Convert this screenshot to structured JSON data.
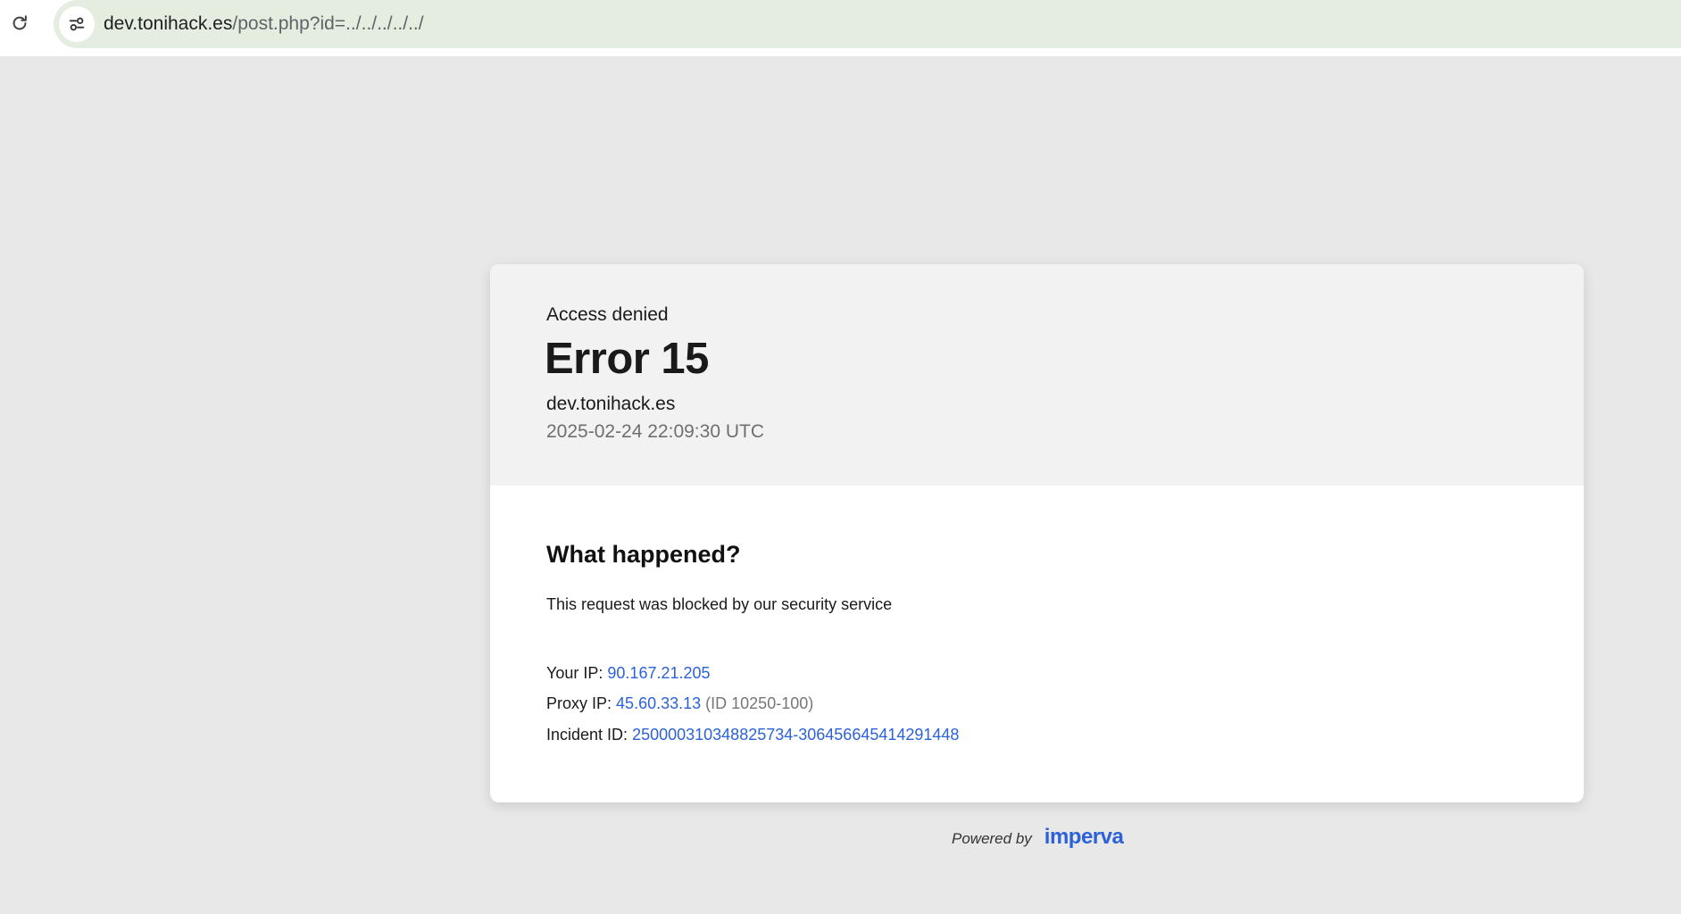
{
  "browser": {
    "url_host": "dev.tonihack.es",
    "url_path": "/post.php?id=../../../../../",
    "reload_icon": "reload-icon",
    "site_info_icon": "tune-icon"
  },
  "error_card": {
    "subtitle": "Access denied",
    "title": "Error 15",
    "host": "dev.tonihack.es",
    "timestamp": "2025-02-24 22:09:30 UTC"
  },
  "details": {
    "heading": "What happened?",
    "message": "This request was blocked by our security service",
    "your_ip_label": "Your IP:",
    "your_ip": "90.167.21.205",
    "proxy_ip_label": "Proxy IP:",
    "proxy_ip": "45.60.33.13",
    "proxy_id": "(ID 10250-100)",
    "incident_label": "Incident ID:",
    "incident_id": "250000310348825734-306456645414291448"
  },
  "footer": {
    "powered_by": "Powered by",
    "brand": "imperva"
  },
  "colors": {
    "page_bg": "#e8e8e8",
    "omnibox_bg": "#e4eddf",
    "link": "#2b62d9",
    "header_bg": "#f2f2f2"
  }
}
